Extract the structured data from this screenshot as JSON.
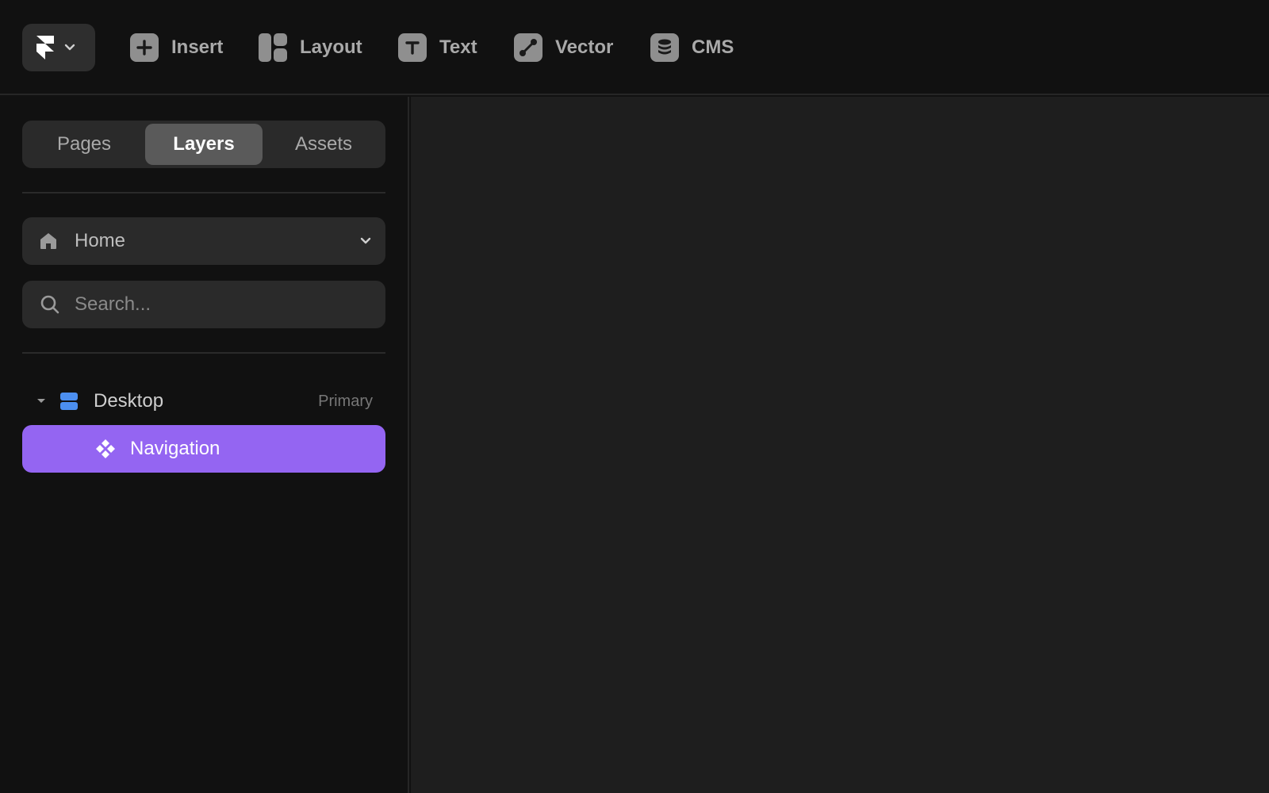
{
  "toolbar": {
    "tools": [
      {
        "label": "Insert",
        "icon": "plus-icon"
      },
      {
        "label": "Layout",
        "icon": "layout-icon"
      },
      {
        "label": "Text",
        "icon": "text-icon"
      },
      {
        "label": "Vector",
        "icon": "vector-pen-icon"
      },
      {
        "label": "CMS",
        "icon": "database-icon"
      }
    ]
  },
  "sidebar": {
    "tabs": [
      {
        "label": "Pages",
        "active": false
      },
      {
        "label": "Layers",
        "active": true
      },
      {
        "label": "Assets",
        "active": false
      }
    ],
    "page_selector": {
      "value": "Home",
      "icon": "home-icon"
    },
    "search": {
      "placeholder": "Search...",
      "value": ""
    },
    "layers": [
      {
        "name": "Desktop",
        "badge": "Primary",
        "icon": "frame-icon",
        "expanded": true
      },
      {
        "name": "Navigation",
        "icon": "component-icon",
        "selected": true
      }
    ]
  },
  "colors": {
    "selection": "#9465f2",
    "frame_icon": "#4c8ff0",
    "canvas": "#1e1e1e",
    "panel": "#111111"
  }
}
